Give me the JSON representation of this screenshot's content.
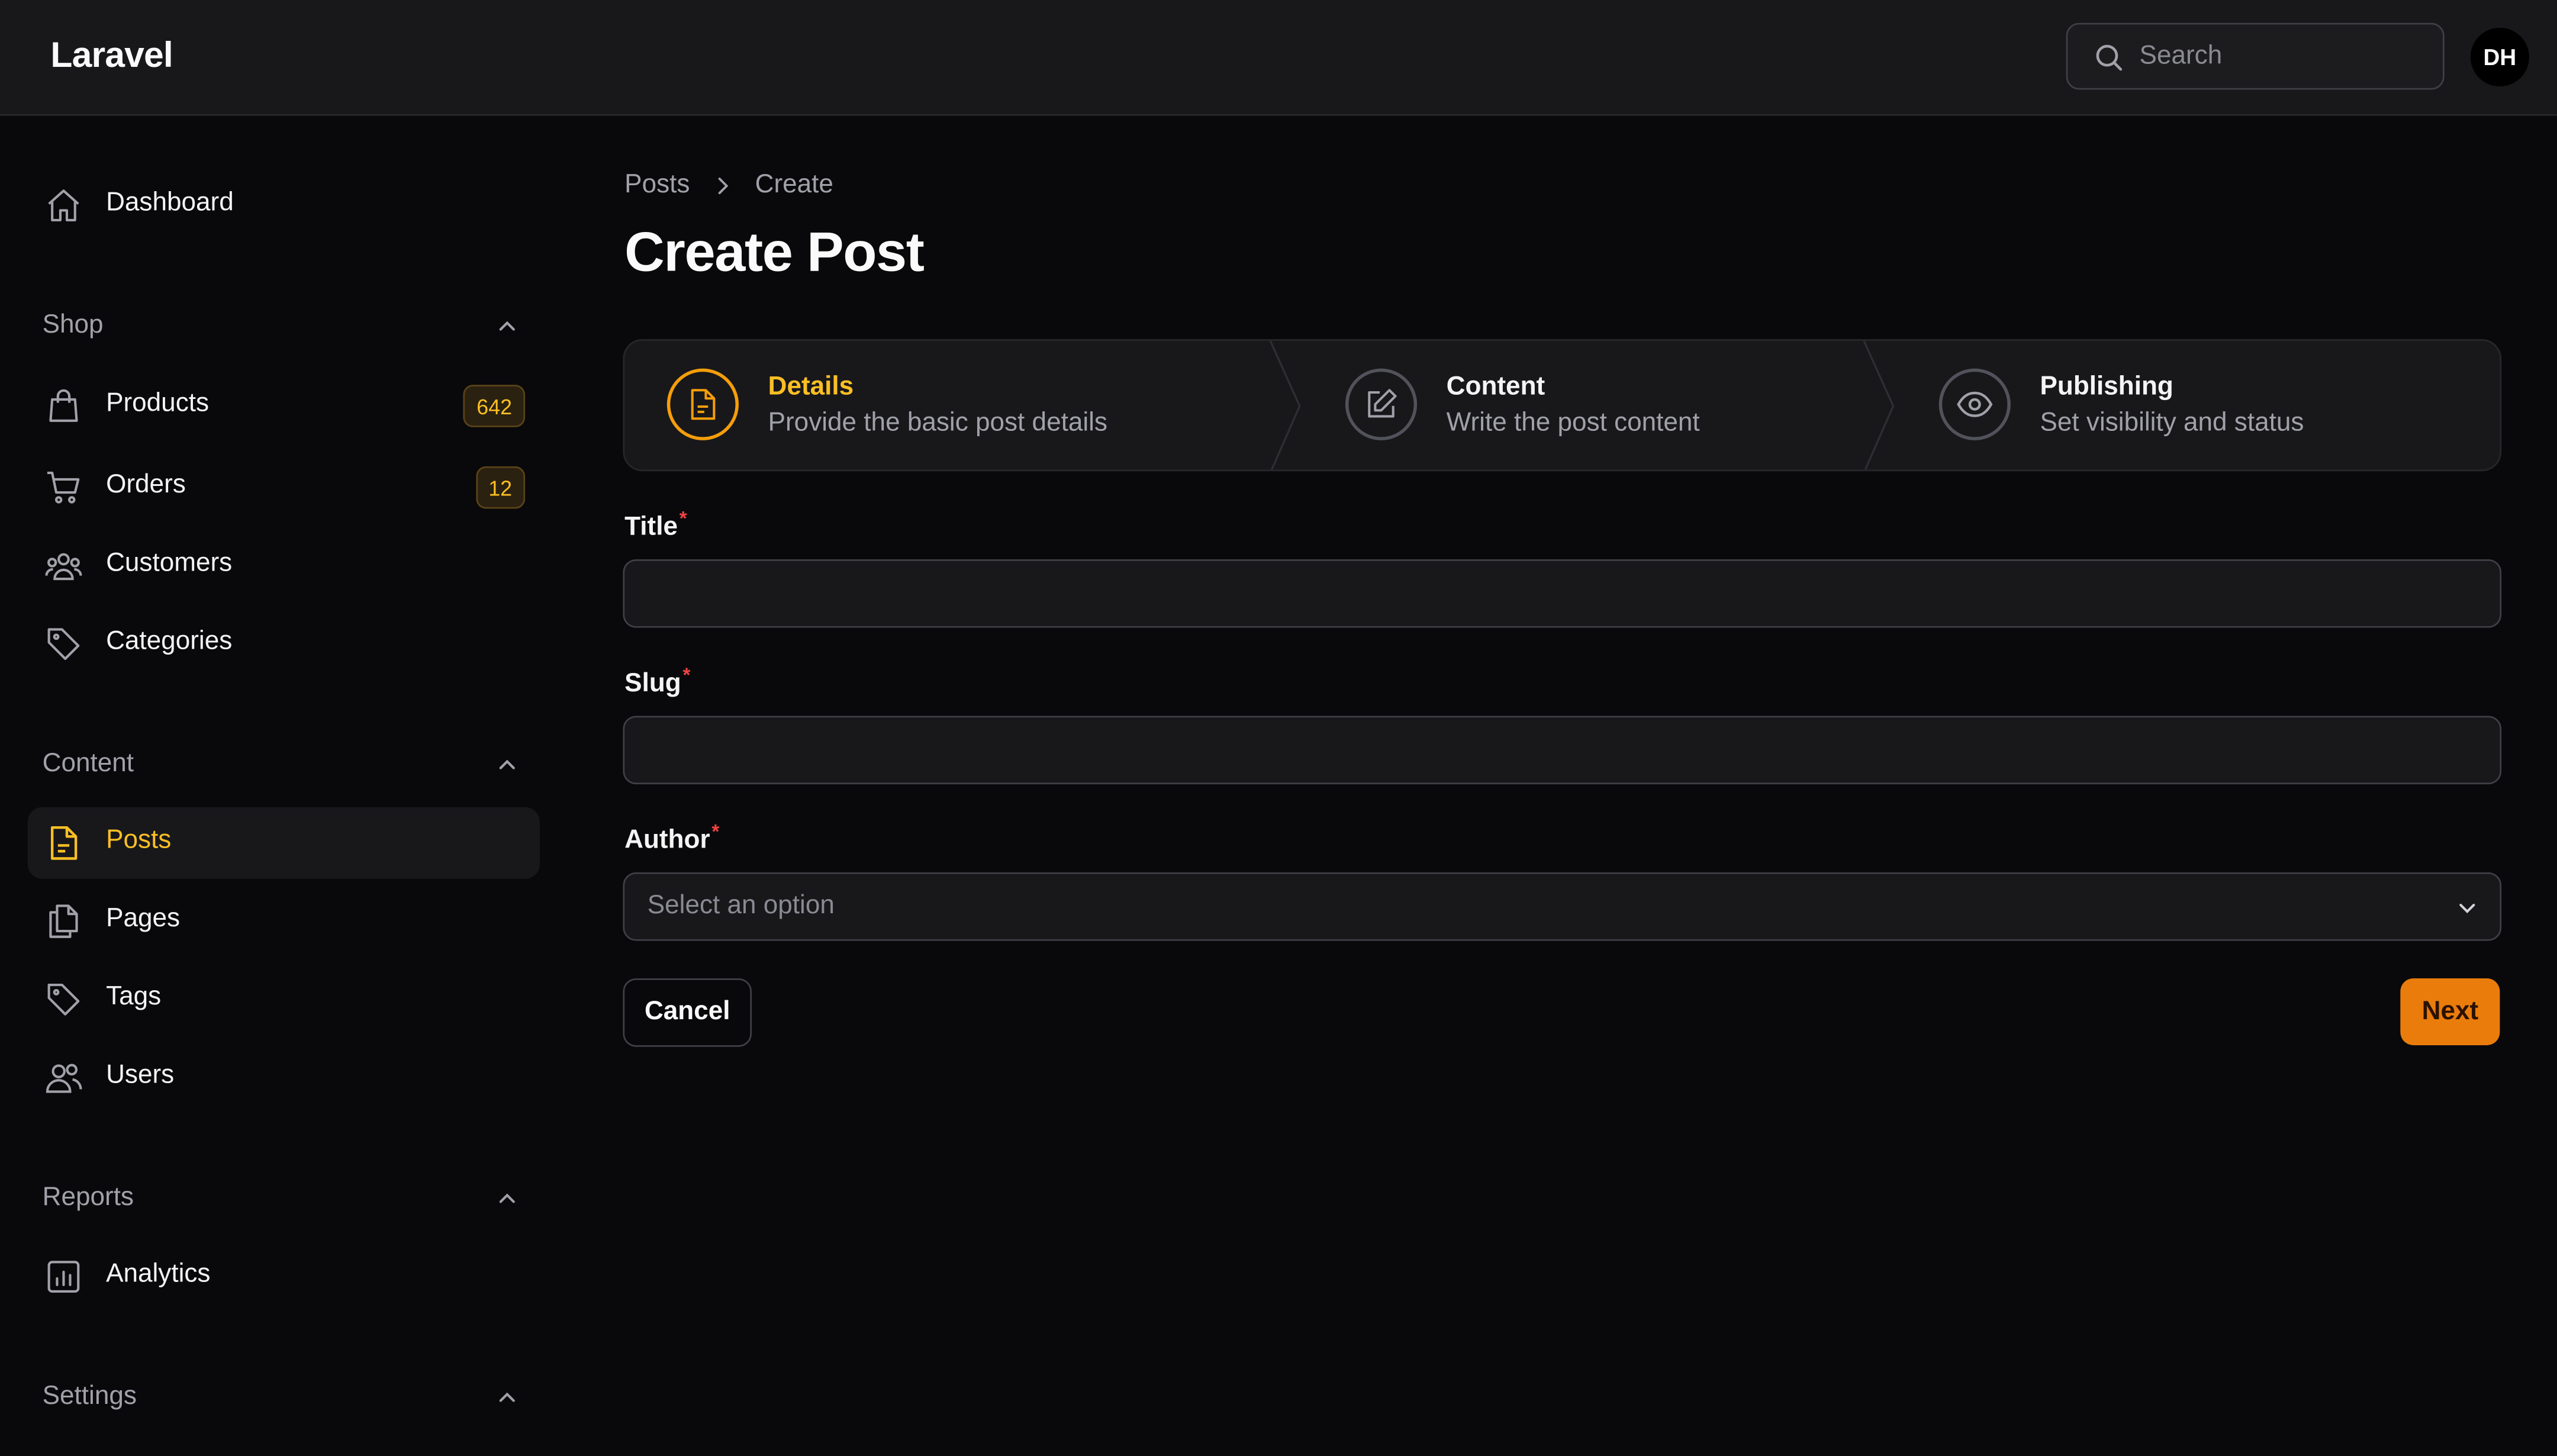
{
  "app": {
    "brand": "Laravel"
  },
  "header": {
    "search_placeholder": "Search",
    "avatar_initials": "DH"
  },
  "sidebar": {
    "dashboard": "Dashboard",
    "groups": {
      "shop": "Shop",
      "content": "Content",
      "reports": "Reports",
      "settings": "Settings"
    },
    "items": {
      "products": {
        "label": "Products",
        "badge": "642"
      },
      "orders": {
        "label": "Orders",
        "badge": "12"
      },
      "customers": {
        "label": "Customers"
      },
      "categories": {
        "label": "Categories"
      },
      "posts": {
        "label": "Posts",
        "active": true
      },
      "pages": {
        "label": "Pages"
      },
      "tags": {
        "label": "Tags"
      },
      "users": {
        "label": "Users"
      },
      "analytics": {
        "label": "Analytics"
      }
    }
  },
  "main": {
    "breadcrumb": [
      "Posts",
      "Create"
    ],
    "title": "Create Post",
    "steps": [
      {
        "title": "Details",
        "description": "Provide the basic post details",
        "icon": "document-icon",
        "current": true
      },
      {
        "title": "Content",
        "description": "Write the post content",
        "icon": "pencil-square-icon",
        "current": false
      },
      {
        "title": "Publishing",
        "description": "Set visibility and status",
        "icon": "eye-icon",
        "current": false
      }
    ],
    "form": {
      "title_label": "Title",
      "title_value": "",
      "slug_label": "Slug",
      "slug_value": "",
      "author_label": "Author",
      "author_placeholder": "Select an option",
      "required_mark": "*"
    },
    "actions": {
      "cancel": "Cancel",
      "next": "Next"
    }
  },
  "colors": {
    "accent": "#f59e0b",
    "accent_text": "#fbbf24",
    "primary_button": "#ea7c0c",
    "required": "#ef4444",
    "background": "#09090b",
    "surface": "#18181b"
  }
}
